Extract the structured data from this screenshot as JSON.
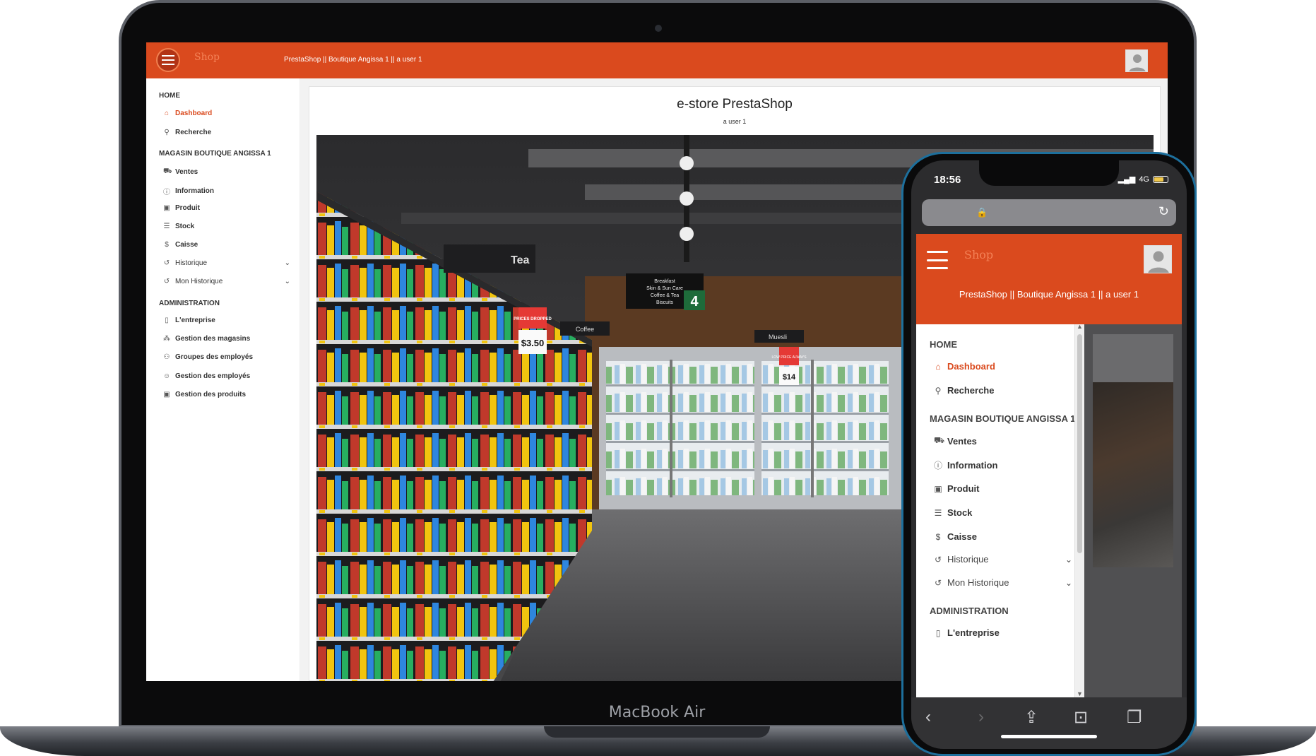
{
  "desktop": {
    "app_title": "PrestaShop || Boutique Angissa 1 || a user 1",
    "logo_text": "Shop",
    "card_title": "e-store PrestaShop",
    "card_subtitle": "a user 1",
    "sidebar": {
      "sections": [
        {
          "label": "HOME",
          "items": [
            {
              "label": "Dashboard",
              "icon": "home-icon"
            },
            {
              "label": "Recherche",
              "icon": "search-icon"
            }
          ]
        },
        {
          "label": "MAGASIN BOUTIQUE ANGISSA 1",
          "items": [
            {
              "label": "Ventes",
              "icon": "cart-icon"
            },
            {
              "label": "Information",
              "icon": "info-icon"
            },
            {
              "label": "Produit",
              "icon": "image-icon"
            },
            {
              "label": "Stock",
              "icon": "database-icon"
            },
            {
              "label": "Caisse",
              "icon": "dollar-icon"
            },
            {
              "label": "Historique",
              "icon": "history-icon"
            },
            {
              "label": "Mon Historique",
              "icon": "history-icon"
            }
          ]
        },
        {
          "label": "ADMINISTRATION",
          "items": [
            {
              "label": "L'entreprise",
              "icon": "building-icon"
            },
            {
              "label": "Gestion des magasins",
              "icon": "sitemap-icon"
            },
            {
              "label": "Groupes des employés",
              "icon": "users-icon"
            },
            {
              "label": "Gestion des employés",
              "icon": "user-icon"
            },
            {
              "label": "Gestion des produits",
              "icon": "image-icon"
            }
          ]
        }
      ]
    },
    "photo_signs": {
      "tea": "Tea",
      "aisle_categories": [
        "Breakfast",
        "Skin & Sun Care",
        "Coffee & Tea",
        "Biscuits"
      ],
      "aisle_number": "4",
      "coffee": "Coffee",
      "muesli": "Muesli",
      "prices_dropped": "PRICES DROPPED",
      "price_main": "$3.50",
      "low_price": "LOW PRICE ALWAYS",
      "price_14": "$14"
    }
  },
  "laptop_label": "MacBook Air",
  "phone": {
    "time": "18:56",
    "network": "4G",
    "app_title": "PrestaShop || Boutique Angissa 1 || a user 1",
    "logo_text": "Shop",
    "sidebar": {
      "home": "HOME",
      "dashboard": "Dashboard",
      "recherche": "Recherche",
      "magasin": "MAGASIN BOUTIQUE ANGISSA 1",
      "ventes": "Ventes",
      "information": "Information",
      "produit": "Produit",
      "stock": "Stock",
      "caisse": "Caisse",
      "historique": "Historique",
      "mon_historique": "Mon Historique",
      "administration": "ADMINISTRATION",
      "entreprise": "L'entreprise"
    }
  },
  "colors": {
    "brand": "#da4a1e",
    "phone_frame": "#1d6f9c"
  }
}
